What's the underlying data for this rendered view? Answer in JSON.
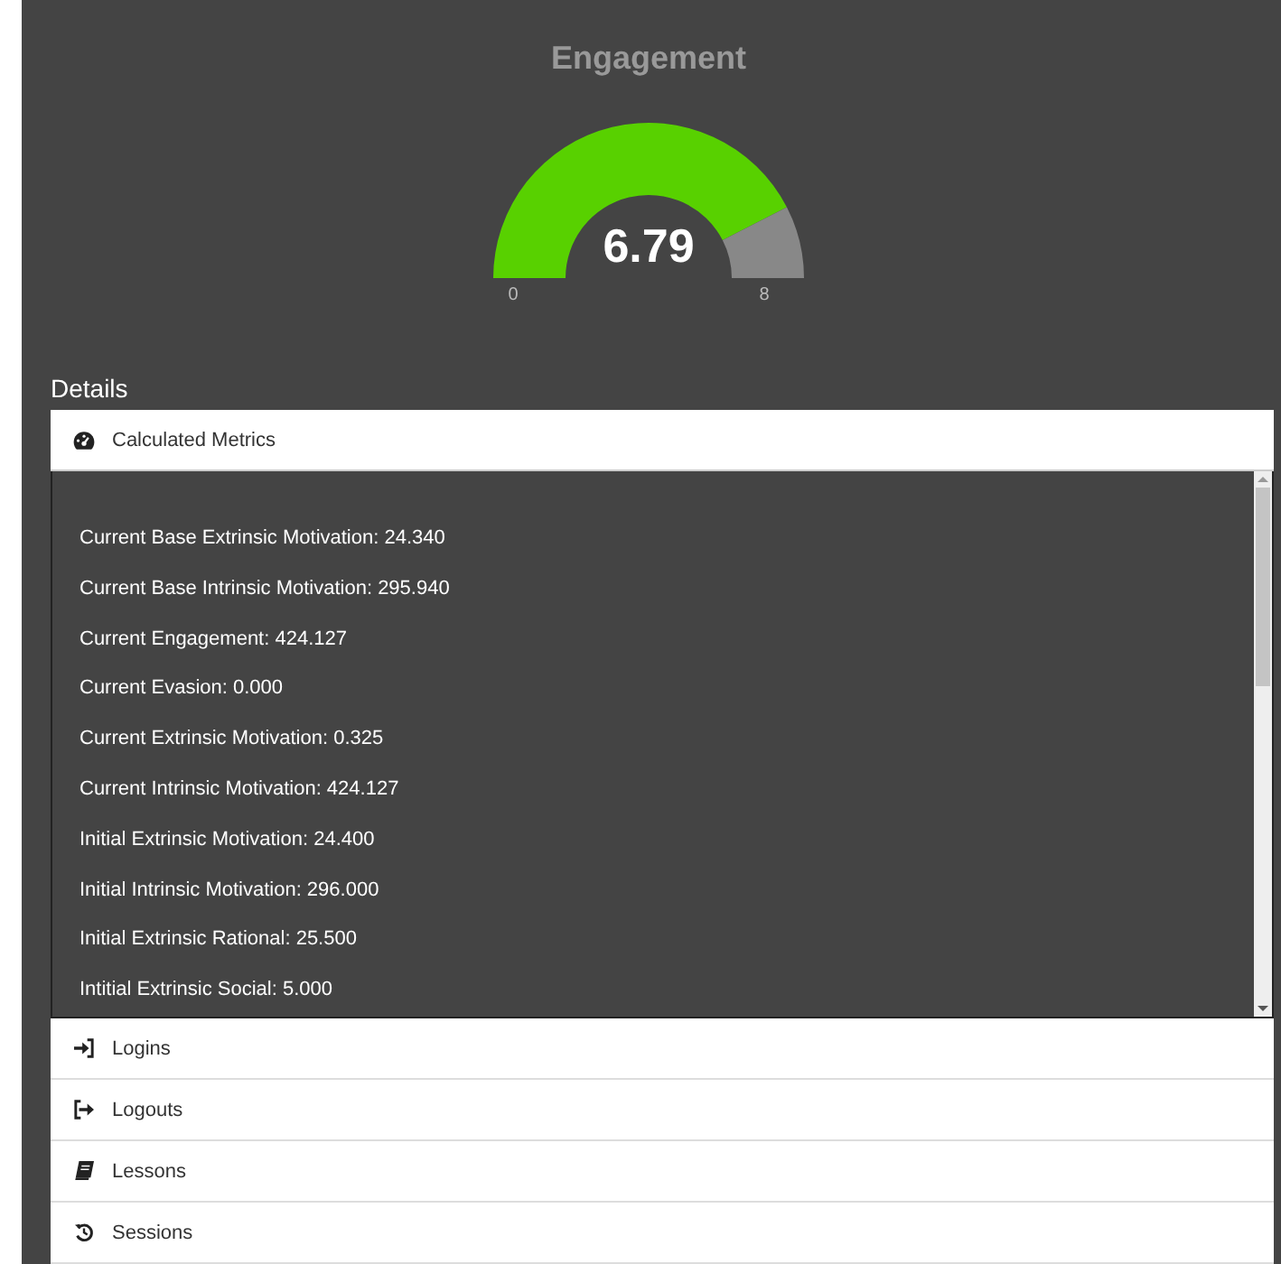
{
  "gauge": {
    "title": "Engagement",
    "value": "6.79",
    "min": "0",
    "max": "8",
    "level": 0.849
  },
  "details": {
    "label": "Details",
    "sections": [
      {
        "kind": "metrics",
        "title": "Calculated Metrics",
        "expanded": true,
        "items": [
          "Current Base Extrinsic Motivation: 24.340",
          "Current Base Intrinsic Motivation: 295.940",
          "Current Engagement: 424.127",
          "Current Evasion: 0.000",
          "Current Extrinsic Motivation: 0.325",
          "Current Intrinsic Motivation: 424.127",
          "Initial Extrinsic Motivation: 24.400",
          "Initial Intrinsic Motivation: 296.000",
          "Initial Extrinsic Rational: 25.500",
          "Intitial Extrinsic Social: 5.000"
        ]
      },
      {
        "kind": "login",
        "title": "Logins",
        "expanded": false
      },
      {
        "kind": "logout",
        "title": "Logouts",
        "expanded": false
      },
      {
        "kind": "book",
        "title": "Lessons",
        "expanded": false
      },
      {
        "kind": "history",
        "title": "Sessions",
        "expanded": false
      }
    ]
  }
}
